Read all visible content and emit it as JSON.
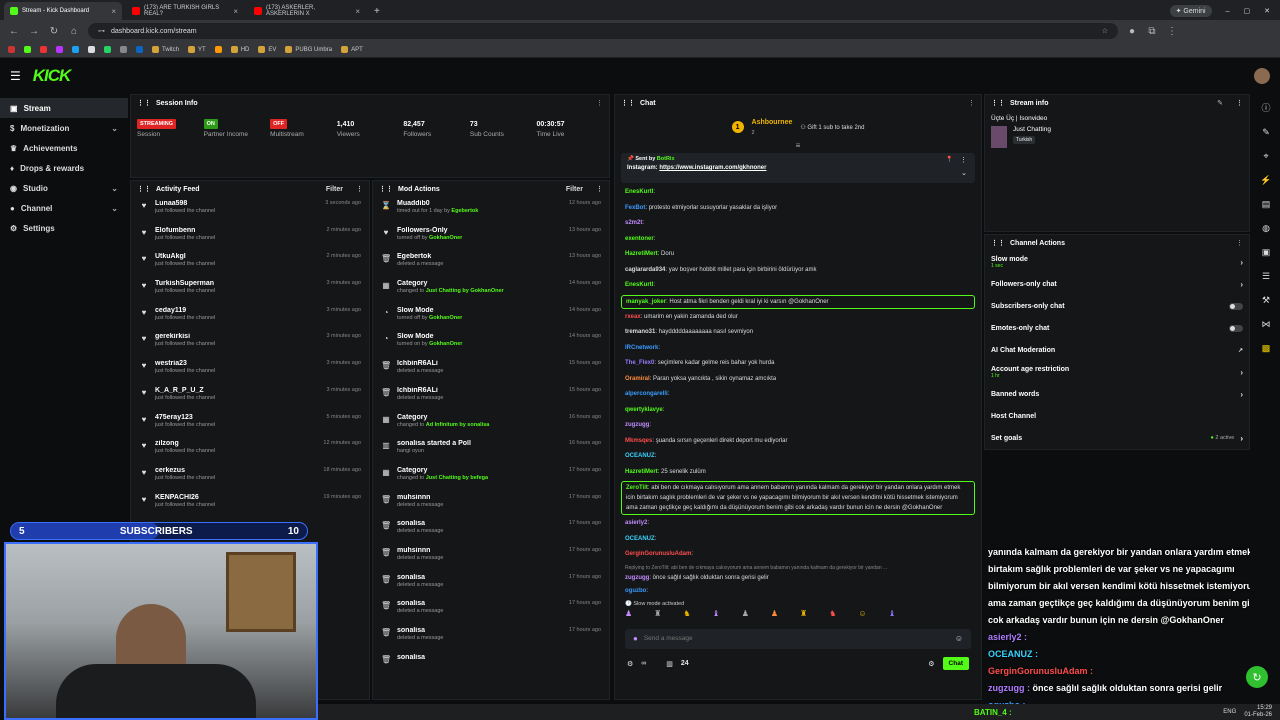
{
  "browser": {
    "tabs": [
      {
        "label": "Stream - Kick Dashboard",
        "icon": "kick-icon",
        "color": "#53fc18"
      },
      {
        "label": "(173) ARE TURKISH GIRLS REAL?",
        "icon": "youtube-icon",
        "color": "#ff0000"
      },
      {
        "label": "(173) ASKERLER, ASKERLERIN X",
        "icon": "youtube-icon",
        "color": "#ff0000"
      }
    ],
    "new_tab": "+",
    "url": "dashboard.kick.com/stream",
    "gemini_label": "Gemini",
    "bookmarks": [
      "Twitch",
      "YT",
      "HD",
      "EV",
      "PUBG Umbra",
      "APT"
    ]
  },
  "nav": {
    "logo": "KICK"
  },
  "sidebar": {
    "items": [
      {
        "label": "Stream",
        "active": true,
        "chevron": false,
        "icon": "broadcast-icon"
      },
      {
        "label": "Monetization",
        "active": false,
        "chevron": true,
        "icon": "dollar-icon"
      },
      {
        "label": "Achievements",
        "active": false,
        "chevron": false,
        "icon": "trophy-icon"
      },
      {
        "label": "Drops & rewards",
        "active": false,
        "chevron": false,
        "icon": "gift-icon"
      },
      {
        "label": "Studio",
        "active": false,
        "chevron": true,
        "icon": "camera-icon"
      },
      {
        "label": "Channel",
        "active": false,
        "chevron": true,
        "icon": "user-icon"
      },
      {
        "label": "Settings",
        "active": false,
        "chevron": false,
        "icon": "gear-icon"
      }
    ]
  },
  "session": {
    "title": "Session Info",
    "stats": [
      {
        "value": "STREAMING",
        "label": "Session",
        "badge": true,
        "color": "#e02424"
      },
      {
        "value": "ON",
        "label": "Partner Income",
        "badge": true,
        "color": "#2e9a1a"
      },
      {
        "value": "OFF",
        "label": "Multistream",
        "badge": true,
        "color": "#e02424"
      },
      {
        "value": "1,410",
        "label": "Viewers",
        "badge": false
      },
      {
        "value": "82,457",
        "label": "Followers",
        "badge": false
      },
      {
        "value": "73",
        "label": "Sub Counts",
        "badge": false
      },
      {
        "value": "00:30:57",
        "label": "Time Live",
        "badge": false
      }
    ]
  },
  "activity": {
    "title": "Activity Feed",
    "filter": "Filter",
    "items": [
      {
        "name": "Lunaa598",
        "sub": "just followed the channel",
        "time": "3 seconds ago"
      },
      {
        "name": "Elofumbenn",
        "sub": "just followed the channel",
        "time": "2 minutes ago"
      },
      {
        "name": "UtkuAkgl",
        "sub": "just followed the channel",
        "time": "2 minutes ago"
      },
      {
        "name": "TurkishSuperman",
        "sub": "just followed the channel",
        "time": "3 minutes ago"
      },
      {
        "name": "ceday119",
        "sub": "just followed the channel",
        "time": "3 minutes ago"
      },
      {
        "name": "gerekirkisi",
        "sub": "just followed the channel",
        "time": "3 minutes ago"
      },
      {
        "name": "westria23",
        "sub": "just followed the channel",
        "time": "3 minutes ago"
      },
      {
        "name": "K_A_R_P_U_Z",
        "sub": "just followed the channel",
        "time": "3 minutes ago"
      },
      {
        "name": "475eray123",
        "sub": "just followed the channel",
        "time": "5 minutes ago"
      },
      {
        "name": "zilzong",
        "sub": "just followed the channel",
        "time": "12 minutes ago"
      },
      {
        "name": "cerkezus",
        "sub": "just followed the channel",
        "time": "18 minutes ago"
      },
      {
        "name": "KENPACHI26",
        "sub": "just followed the channel",
        "time": "19 minutes ago"
      }
    ]
  },
  "mod": {
    "title": "Mod Actions",
    "filter": "Filter",
    "items": [
      {
        "icon": "hourglass-icon",
        "name": "Muaddib0",
        "pre": "timed out for 1 day by",
        "hl": "Egebertok",
        "time": "12 hours ago"
      },
      {
        "icon": "heart-icon",
        "name": "Followers-Only",
        "pre": "turned off by",
        "hl": "GokhanOner",
        "time": "13 hours ago"
      },
      {
        "icon": "trash-icon",
        "name": "Egebertok",
        "pre": "deleted a message",
        "hl": "",
        "time": "13 hours ago"
      },
      {
        "icon": "category-icon",
        "name": "Category",
        "pre": "changed to",
        "hl": "Just Chatting by GokhanOner",
        "time": "14 hours ago"
      },
      {
        "icon": "snail-icon",
        "name": "Slow Mode",
        "pre": "turned off by",
        "hl": "GokhanOner",
        "time": "14 hours ago"
      },
      {
        "icon": "snail-icon",
        "name": "Slow Mode",
        "pre": "turned on by",
        "hl": "GokhanOner",
        "time": "14 hours ago"
      },
      {
        "icon": "trash-icon",
        "name": "IchbinR6ALi",
        "pre": "deleted a message",
        "hl": "",
        "time": "15 hours ago"
      },
      {
        "icon": "trash-icon",
        "name": "IchbinR6ALi",
        "pre": "deleted a message",
        "hl": "",
        "time": "15 hours ago"
      },
      {
        "icon": "category-icon",
        "name": "Category",
        "pre": "changed to",
        "hl": "Ad Infinitum by sonalisa",
        "time": "16 hours ago"
      },
      {
        "icon": "poll-icon",
        "name": "sonalisa started a Poll",
        "pre": "hangi oyun",
        "hl": "",
        "time": "16 hours ago"
      },
      {
        "icon": "category-icon",
        "name": "Category",
        "pre": "changed to",
        "hl": "Just Chatting by befega",
        "time": "17 hours ago"
      },
      {
        "icon": "trash-icon",
        "name": "muhsinnn",
        "pre": "deleted a message",
        "hl": "",
        "time": "17 hours ago"
      },
      {
        "icon": "trash-icon",
        "name": "sonalisa",
        "pre": "deleted a message",
        "hl": "",
        "time": "17 hours ago"
      },
      {
        "icon": "trash-icon",
        "name": "muhsinnn",
        "pre": "deleted a message",
        "hl": "",
        "time": "17 hours ago"
      },
      {
        "icon": "trash-icon",
        "name": "sonalisa",
        "pre": "deleted a message",
        "hl": "",
        "time": "17 hours ago"
      },
      {
        "icon": "trash-icon",
        "name": "sonalisa",
        "pre": "deleted a message",
        "hl": "",
        "time": "17 hours ago"
      },
      {
        "icon": "trash-icon",
        "name": "sonalisa",
        "pre": "deleted a message",
        "hl": "",
        "time": "17 hours ago"
      },
      {
        "icon": "trash-icon",
        "name": "sonalisa",
        "pre": "",
        "hl": "",
        "time": ""
      }
    ]
  },
  "chat": {
    "title": "Chat",
    "top_gifter": "Ashbournee",
    "top_gifter_count": "2",
    "gift_hint": "Gift 1 sub to take 2nd",
    "pinned_by": "Sent by",
    "pinned_user": "BotRix",
    "pinned_text": "Instagram:",
    "pinned_link": "https://www.instagram.com/gkhnoner",
    "lines": [
      {
        "u": "EnesKurtl",
        "c": "#53fc18",
        "m": ""
      },
      {
        "u": "FexBot",
        "c": "#3b9bff",
        "m": "protesto etmiyorlar susuyorlar yasaklar da işliyor"
      },
      {
        "u": "s2m2t",
        "c": "#c48cff",
        "m": ""
      },
      {
        "u": "exentoner",
        "c": "#53fc18",
        "m": ""
      },
      {
        "u": "HazretiMert",
        "c": "#53fc18",
        "m": "Doru"
      },
      {
        "u": "caglararda934",
        "c": "#ddd",
        "m": "yav boşver hobbit millet para için birbirini öldürüyor amk"
      },
      {
        "u": "EnesKurtl",
        "c": "#53fc18",
        "m": ""
      },
      {
        "u": "manyak_joker",
        "c": "#53fc18",
        "m": "Host atma fikri benden geldi kral iyi ki varsın @GokhanOner",
        "hl": true
      },
      {
        "u": "rxeax",
        "c": "#ff4d4d",
        "m": "umarim en yakin zamanda ded olur"
      },
      {
        "u": "tremano31",
        "c": "#ddd",
        "m": "haydddddaaaaaaaa nasıl sevmiyon"
      },
      {
        "u": "IRCnetwork",
        "c": "#3b9bff",
        "m": ""
      },
      {
        "u": "The_Flex0",
        "c": "#9a7bff",
        "m": "seçimlere kadar gelme reis bahar yok hurda"
      },
      {
        "u": "Oramiral",
        "c": "#ff8c3b",
        "m": "Paran yoksa yancıkta , sikin oynamaz amcıkta"
      },
      {
        "u": "alpercongarelli",
        "c": "#3b9bff",
        "m": ""
      },
      {
        "u": "qwertyklavye",
        "c": "#53fc18",
        "m": ""
      },
      {
        "u": "zugzugg",
        "c": "#c48cff",
        "m": ""
      },
      {
        "u": "Mkmsqes",
        "c": "#ff4d4d",
        "m": "şuanda sırsın geçenleri direkt deport mu ediyorlar"
      },
      {
        "u": "OCEANUZ",
        "c": "#3bd3ff",
        "m": ""
      },
      {
        "u": "HazretiMert",
        "c": "#53fc18",
        "m": "25 senelik zulüm"
      }
    ],
    "big_user": "ZeroTilt",
    "big_msg": "abi ben de cıkmaya calısıyorum ama annem babamın yanında kalmam da gerekiyor bir yandan onlara yardım etmek icin birtakım saglık problemleri de var şeker vs ne yapacagımı bilmiyorum bir akıl versen kendimi kötü hissetmek istemiyorum ama zaman geçtikçe geç kaldığımı da düşünüyorum benim gibi cok arkadaş vardır bunun icin ne dersin @GokhanOner",
    "lines2": [
      {
        "u": "asierly2",
        "c": "#c48cff",
        "m": ""
      },
      {
        "u": "OCEANUZ",
        "c": "#3bd3ff",
        "m": ""
      },
      {
        "u": "GerginGorunusluAdam",
        "c": "#ff4d4d",
        "m": ""
      }
    ],
    "reply_hint": "Replying to ZeroTilt: abi ben de cıkmaya calısıyorum ama annem babamın yanında kalmam da gerekiyor bir yandan ...",
    "reply_user": "zugzugg",
    "reply_msg": "önce sağlıl sağlık olduktan sonra gerisi gelir",
    "last_user": "oguzbo",
    "slow_mode": "Slow mode activated",
    "placeholder": "Send a message",
    "viewers": "24",
    "send": "Chat"
  },
  "stream_info": {
    "title": "Stream info",
    "stream_title": "Üçte Üç | Isonvideo",
    "category": "Just Chatting",
    "tag": "Turkish"
  },
  "channel_actions": {
    "title": "Channel Actions",
    "items": [
      {
        "label": "Slow mode",
        "sub": "1 sec",
        "control": "chevron"
      },
      {
        "label": "Followers-only chat",
        "sub": "",
        "control": "chevron"
      },
      {
        "label": "Subscribers-only chat",
        "sub": "",
        "control": "toggle"
      },
      {
        "label": "Emotes-only chat",
        "sub": "",
        "control": "toggle"
      },
      {
        "label": "AI Chat Moderation",
        "sub": "",
        "control": "external"
      },
      {
        "label": "Account age restriction",
        "sub": "1 hr",
        "control": "chevron"
      },
      {
        "label": "Banned words",
        "sub": "",
        "control": "chevron"
      },
      {
        "label": "Host Channel",
        "sub": "",
        "control": "none"
      },
      {
        "label": "Set goals",
        "sub": "",
        "control": "active",
        "active_text": "2 active"
      }
    ]
  },
  "overlay": {
    "sub_goal_current": "5",
    "sub_goal_label": "SUBSCRIBERS",
    "sub_goal_target": "10",
    "big_chat_lines": [
      "yanında kalmam da gerekiyor bir yandan onlara yardım etmek için",
      "birtakım sağlık problemleri de var şeker vs ne yapacagımı",
      "bilmiyorum bir akıl versen kendimi kötü hissetmek istemiyorum",
      "ama zaman geçtikçe geç kaldığımı da düşünüyorum benim gibi",
      "cok arkadaş vardır bunun için ne dersin @GokhanOner"
    ],
    "big_lines2": [
      {
        "u": "asierly2 :",
        "c": "#b07cff",
        "m": ""
      },
      {
        "u": "OCEANUZ :",
        "c": "#3bd3ff",
        "m": ""
      },
      {
        "u": "GerginGorunusluAdam :",
        "c": "#ff4d4d",
        "m": ""
      },
      {
        "u": "zugzugg :",
        "c": "#b07cff",
        "m": "önce sağlıl sağlık olduktan sonra gerisi gelir"
      },
      {
        "u": "oguzbo :",
        "c": "#3b9bff",
        "m": ""
      }
    ],
    "bottom_user": "BATIN_4 :"
  },
  "taskbar": {
    "lang": "ENG",
    "time": "15:29",
    "date": "01-Feb-26"
  }
}
